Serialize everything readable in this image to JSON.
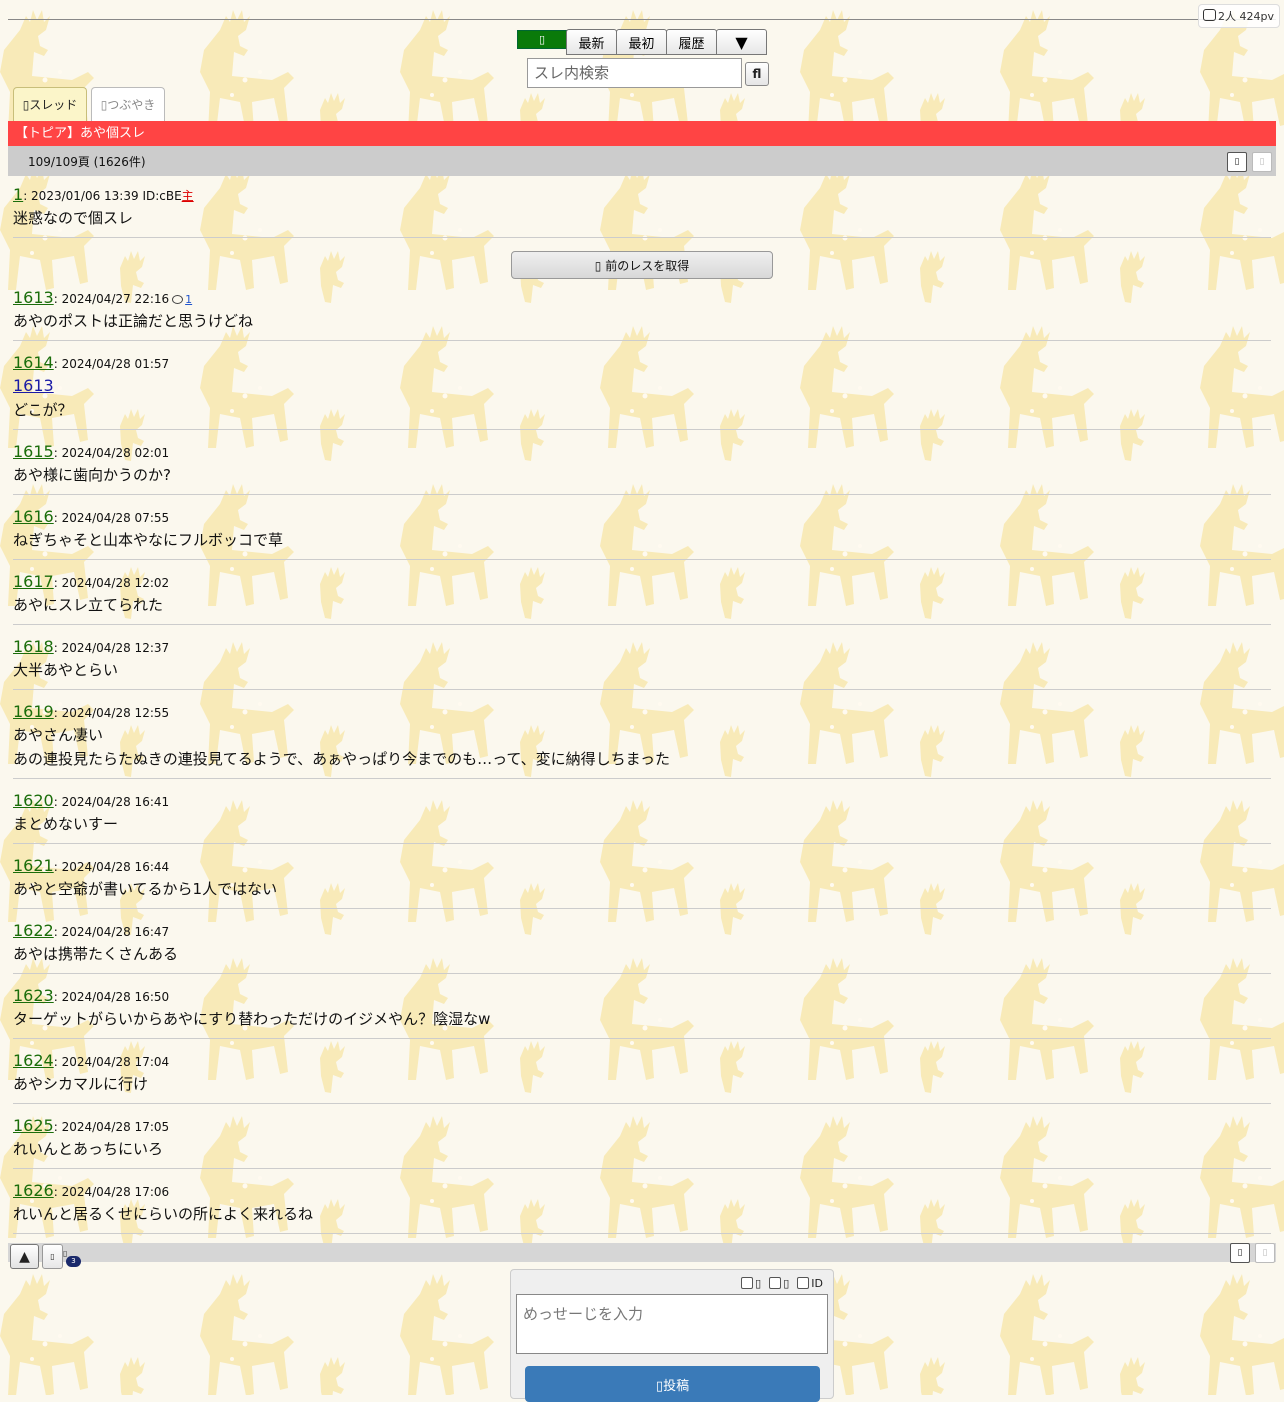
{
  "stats": {
    "text": "2人 424pv"
  },
  "nav": {
    "green_label": "▯",
    "buttons": [
      "最新",
      "最初",
      "履歴",
      "▼"
    ]
  },
  "search": {
    "placeholder": "スレ内検索",
    "button_label": "fl"
  },
  "tabs": {
    "thread": "▯スレッド",
    "tweet": "▯つぶやき"
  },
  "thread": {
    "title": "【トピア】あや個スレ",
    "page_info": "109/109頁 (1626件)",
    "first_post": {
      "num": "1",
      "date": "2023/01/06 13:39",
      "id": "ID:cBE",
      "owner": "主",
      "body": "迷惑なので個スレ"
    },
    "load_prev_label": "▯ 前のレスを取得",
    "posts": [
      {
        "num": "1613",
        "date": "2024/04/27 22:16",
        "reply_count": "1",
        "lines": [
          "あやのポストは正論だと思うけどね"
        ]
      },
      {
        "num": "1614",
        "date": "2024/04/28 01:57",
        "anchor": "1613",
        "lines": [
          "どこが？"
        ]
      },
      {
        "num": "1615",
        "date": "2024/04/28 02:01",
        "lines": [
          "あや様に歯向かうのか?"
        ]
      },
      {
        "num": "1616",
        "date": "2024/04/28 07:55",
        "lines": [
          "ねぎちゃそと山本やなにフルボッコで草"
        ]
      },
      {
        "num": "1617",
        "date": "2024/04/28 12:02",
        "lines": [
          "あやにスレ立てられた"
        ]
      },
      {
        "num": "1618",
        "date": "2024/04/28 12:37",
        "lines": [
          "大半あやとらい"
        ]
      },
      {
        "num": "1619",
        "date": "2024/04/28 12:55",
        "lines": [
          "あやさん凄い",
          "あの連投見たらたぬきの連投見てるようで、あぁやっぱり今までのも…って、変に納得しちまった"
        ]
      },
      {
        "num": "1620",
        "date": "2024/04/28 16:41",
        "lines": [
          "まとめないすー"
        ]
      },
      {
        "num": "1621",
        "date": "2024/04/28 16:44",
        "lines": [
          "あやと空爺が書いてるから1人ではない"
        ]
      },
      {
        "num": "1622",
        "date": "2024/04/28 16:47",
        "lines": [
          "あやは携帯たくさんある"
        ]
      },
      {
        "num": "1623",
        "date": "2024/04/28 16:50",
        "lines": [
          "ターゲットがらいからあやにすり替わっただけのイジメやん？陰湿なw"
        ]
      },
      {
        "num": "1624",
        "date": "2024/04/28 17:04",
        "lines": [
          "あやシカマルに行け"
        ]
      },
      {
        "num": "1625",
        "date": "2024/04/28 17:05",
        "lines": [
          "れいんとあっちにいろ"
        ]
      },
      {
        "num": "1626",
        "date": "2024/04/28 17:06",
        "lines": [
          "れいんと居るくせにらいの所によく来れるね"
        ]
      }
    ]
  },
  "bottom": {
    "up_label": "▲",
    "small_label": "▯",
    "notif_label": "▯",
    "badge": "3"
  },
  "form": {
    "opt1": "▯",
    "opt2": "▯",
    "opt3": "ID",
    "message_placeholder": "めっせーじを入力",
    "submit_label": "▯投稿"
  }
}
